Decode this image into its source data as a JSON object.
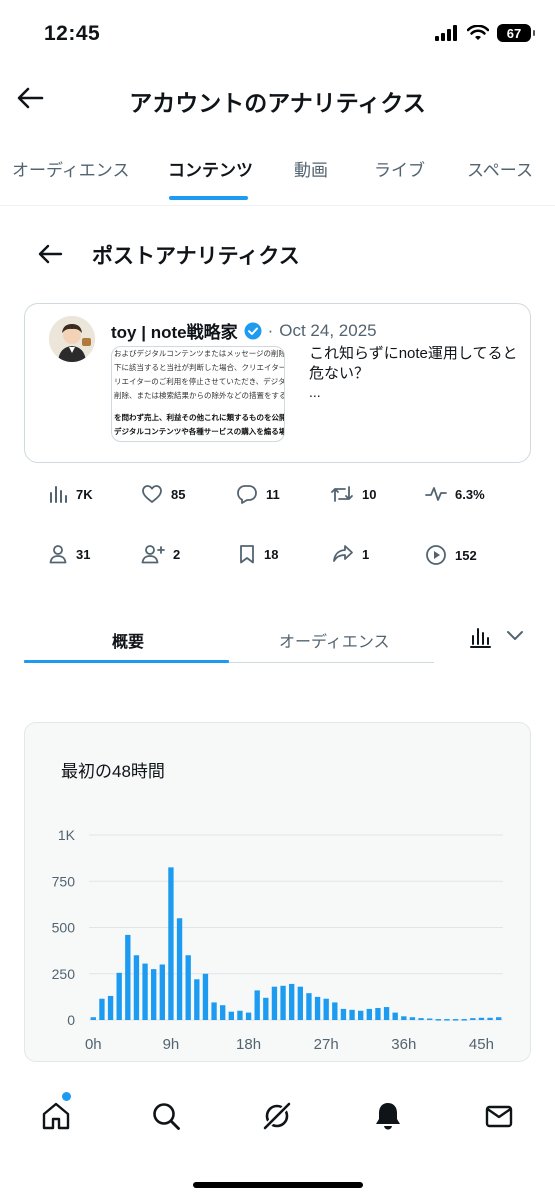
{
  "status": {
    "time": "12:45",
    "battery": "67"
  },
  "header": {
    "title": "アカウントのアナリティクス"
  },
  "top_tabs": [
    {
      "label": "オーディエンス"
    },
    {
      "label": "コンテンツ"
    },
    {
      "label": "動画"
    },
    {
      "label": "ライブ"
    },
    {
      "label": "スペース"
    }
  ],
  "post_analytics": {
    "title": "ポストアナリティクス"
  },
  "post": {
    "author": "toy | note戦略家",
    "separator": "·",
    "date": "Oct 24, 2025",
    "text": "これ知らずにnote運用してると危ない？",
    "ellipsis": "...",
    "thumbnail_lines": [
      "およびデジタルコンテンツまたはメッセージの削除",
      "下に該当すると当社が判断した場合、クリエイター",
      "リエイターのご利用を停止させていただき、デジタル",
      "削除、または検索結果からの除外などの措置をするこ",
      "",
      "を問わず売上、利益その他これに類するものを公開",
      "デジタルコンテンツや各種サービスの購入を煽る場"
    ]
  },
  "metrics_row1": [
    {
      "icon": "views-icon",
      "value": "7K"
    },
    {
      "icon": "heart-icon",
      "value": "85"
    },
    {
      "icon": "reply-icon",
      "value": "11"
    },
    {
      "icon": "repost-icon",
      "value": "10"
    },
    {
      "icon": "engagement-icon",
      "value": "6.3%"
    }
  ],
  "metrics_row2": [
    {
      "icon": "profile-icon",
      "value": "31"
    },
    {
      "icon": "follow-icon",
      "value": "2"
    },
    {
      "icon": "bookmark-icon",
      "value": "18"
    },
    {
      "icon": "share-icon",
      "value": "1"
    },
    {
      "icon": "play-icon",
      "value": "152"
    }
  ],
  "sub_tabs": [
    {
      "label": "概要"
    },
    {
      "label": "オーディエンス"
    }
  ],
  "colors": {
    "accent": "#1d9bf0",
    "text": "#0f1419",
    "muted": "#536471"
  },
  "chart_data": {
    "type": "bar",
    "title": "最初の48時間",
    "ylim": [
      0,
      1000
    ],
    "yticks": [
      {
        "value": 0,
        "label": "0"
      },
      {
        "value": 250,
        "label": "250"
      },
      {
        "value": 500,
        "label": "500"
      },
      {
        "value": 750,
        "label": "750"
      },
      {
        "value": 1000,
        "label": "1K"
      }
    ],
    "xticks": [
      {
        "hour": 0,
        "label": "0h"
      },
      {
        "hour": 9,
        "label": "9h"
      },
      {
        "hour": 18,
        "label": "18h"
      },
      {
        "hour": 27,
        "label": "27h"
      },
      {
        "hour": 36,
        "label": "36h"
      },
      {
        "hour": 45,
        "label": "45h"
      }
    ],
    "hours": [
      0,
      1,
      2,
      3,
      4,
      5,
      6,
      7,
      8,
      9,
      10,
      11,
      12,
      13,
      14,
      15,
      16,
      17,
      18,
      19,
      20,
      21,
      22,
      23,
      24,
      25,
      26,
      27,
      28,
      29,
      30,
      31,
      32,
      33,
      34,
      35,
      36,
      37,
      38,
      39,
      40,
      41,
      42,
      43,
      44,
      45,
      46,
      47
    ],
    "values": [
      15,
      115,
      130,
      255,
      460,
      350,
      305,
      275,
      300,
      825,
      550,
      350,
      220,
      250,
      95,
      80,
      45,
      50,
      40,
      160,
      120,
      180,
      185,
      195,
      180,
      145,
      125,
      115,
      95,
      60,
      55,
      50,
      60,
      65,
      70,
      40,
      20,
      15,
      10,
      8,
      5,
      5,
      5,
      5,
      10,
      12,
      12,
      15
    ],
    "color": "#1d9bf0"
  }
}
